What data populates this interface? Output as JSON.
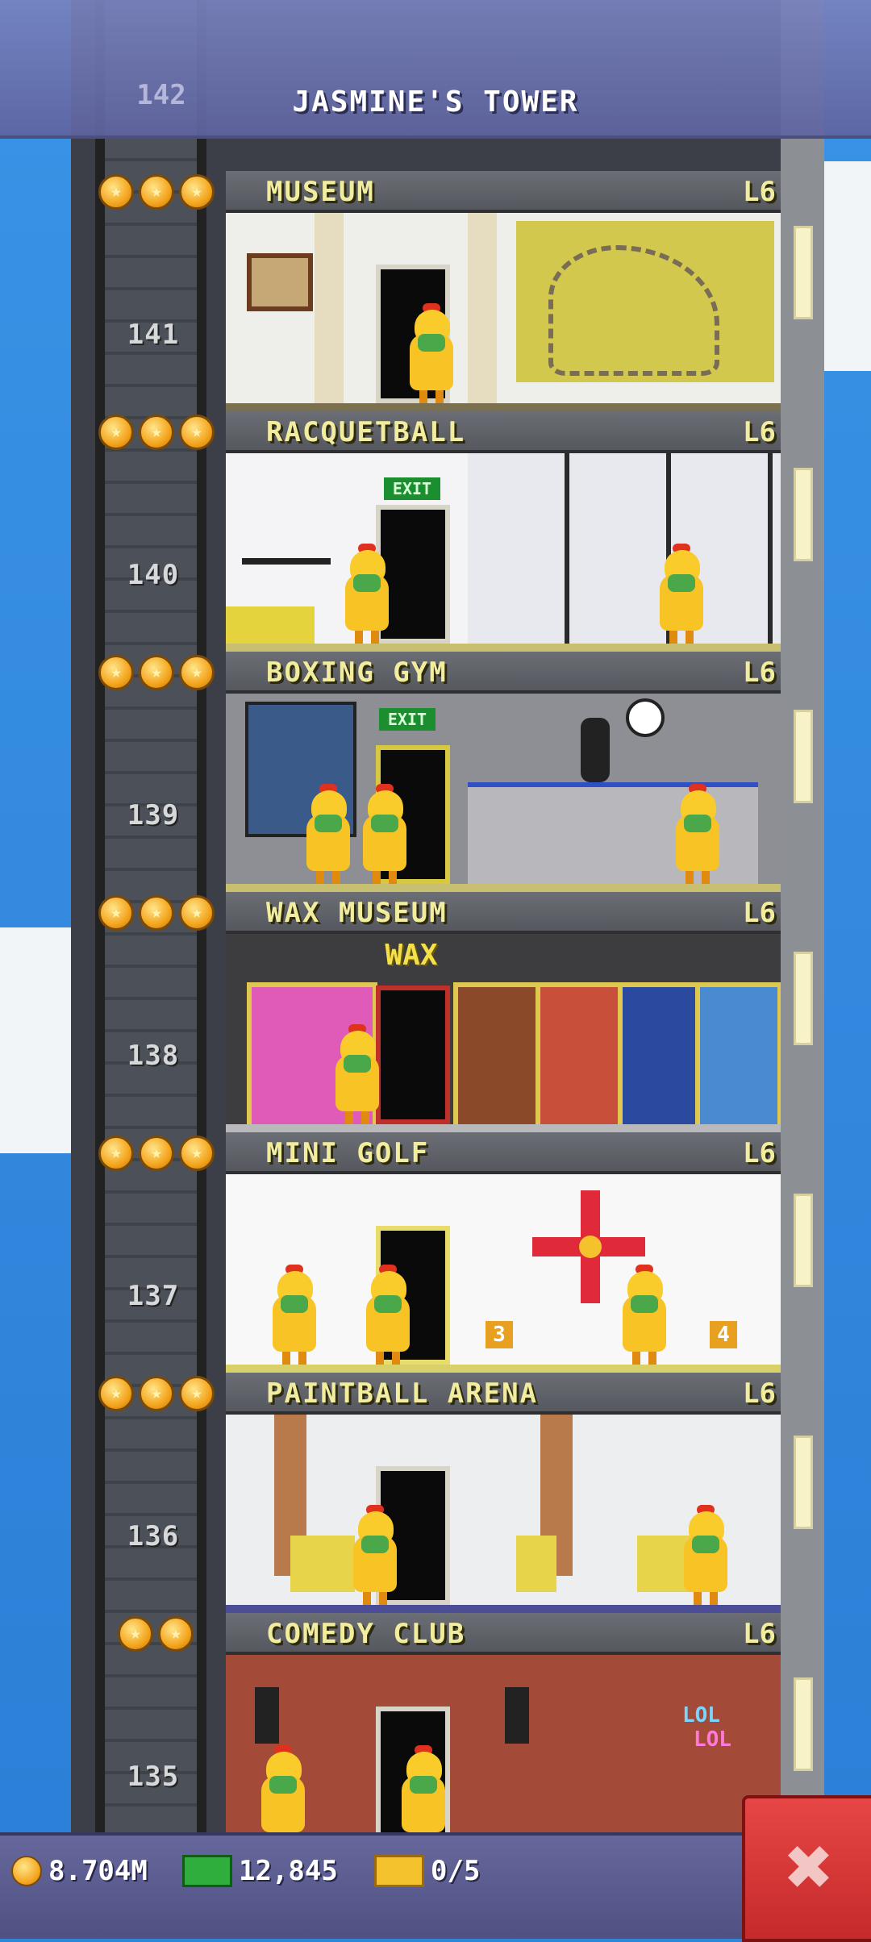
{
  "header": {
    "title": "JASMINE'S TOWER",
    "top_floor_number": "142"
  },
  "floors": [
    {
      "name": "MUSEUM",
      "level": "L6",
      "number": "141",
      "stars": 3
    },
    {
      "name": "RACQUETBALL",
      "level": "L6",
      "number": "140",
      "stars": 3
    },
    {
      "name": "BOXING GYM",
      "level": "L6",
      "number": "139",
      "stars": 3
    },
    {
      "name": "WAX MUSEUM",
      "level": "L6",
      "number": "138",
      "stars": 3
    },
    {
      "name": "MINI GOLF",
      "level": "L6",
      "number": "137",
      "stars": 3
    },
    {
      "name": "PAINTBALL ARENA",
      "level": "L6",
      "number": "136",
      "stars": 3
    },
    {
      "name": "COMEDY CLUB",
      "level": "L6",
      "number": "135",
      "stars": 2
    }
  ],
  "room_signs": {
    "exit1": "EXIT",
    "exit2": "EXIT",
    "wax": "WAX",
    "golf_hole_a": "3",
    "golf_hole_b": "4",
    "lol1": "LOL",
    "lol2": "LOL"
  },
  "status": {
    "coins": "8.704M",
    "bux": "12,845",
    "tickets": "0/5"
  },
  "colors": {
    "sky": "#2f86d9",
    "floor_label": "#f2ec9e",
    "close_button": "#d83232"
  },
  "icons": {
    "coin": "coin-icon",
    "bux": "bux-icon",
    "ticket": "ticket-icon",
    "close": "close-icon"
  }
}
